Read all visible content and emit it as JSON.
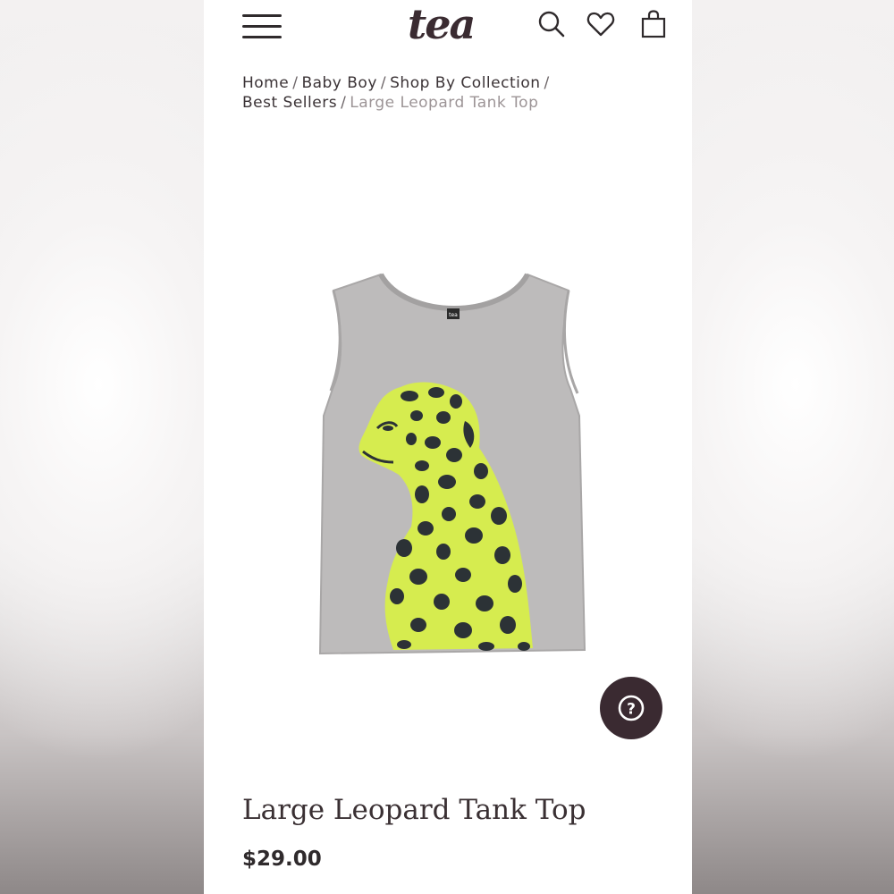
{
  "header": {
    "logo_text": "tea",
    "menu_icon": "hamburger-menu-icon",
    "search_icon": "search-icon",
    "wishlist_icon": "heart-icon",
    "bag_icon": "shopping-bag-icon"
  },
  "breadcrumb": {
    "items": [
      "Home",
      "Baby Boy",
      "Shop By Collection",
      "Best Sellers"
    ],
    "current": "Large Leopard Tank Top",
    "separator": "/"
  },
  "product": {
    "title": "Large Leopard Tank Top",
    "price": "$29.00",
    "label_text": "tea",
    "image_icon": "leopard-tank-top-image"
  },
  "help": {
    "icon": "question-mark-icon",
    "glyph": "?"
  },
  "colors": {
    "brand": "#3a2a31",
    "shirt": "#bdbbbb",
    "leopard": "#d6ec4f",
    "spots": "#2c3236",
    "text": "#2f2a2c",
    "breadcrumb_current": "#9c9496"
  }
}
